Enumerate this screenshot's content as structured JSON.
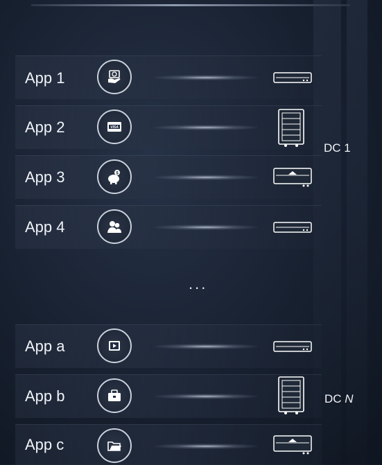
{
  "apps_group_1": [
    "App 1",
    "App 2",
    "App 3",
    "App 4"
  ],
  "apps_group_2": [
    "App a",
    "App b",
    "App c"
  ],
  "ellipsis": "...",
  "dc1": {
    "label": "DC 1"
  },
  "dcN": {
    "prefix": "DC ",
    "suffix": "N"
  },
  "icons": [
    "money-hand-icon",
    "credit-card-icon",
    "piggy-bank-icon",
    "users-icon",
    "video-icon",
    "briefcase-icon",
    "folder-icon"
  ],
  "card_text": "VISA",
  "colors": {
    "background": "#17202f",
    "text": "#f0f3f8",
    "icon_ring": "#c9d1dc"
  }
}
